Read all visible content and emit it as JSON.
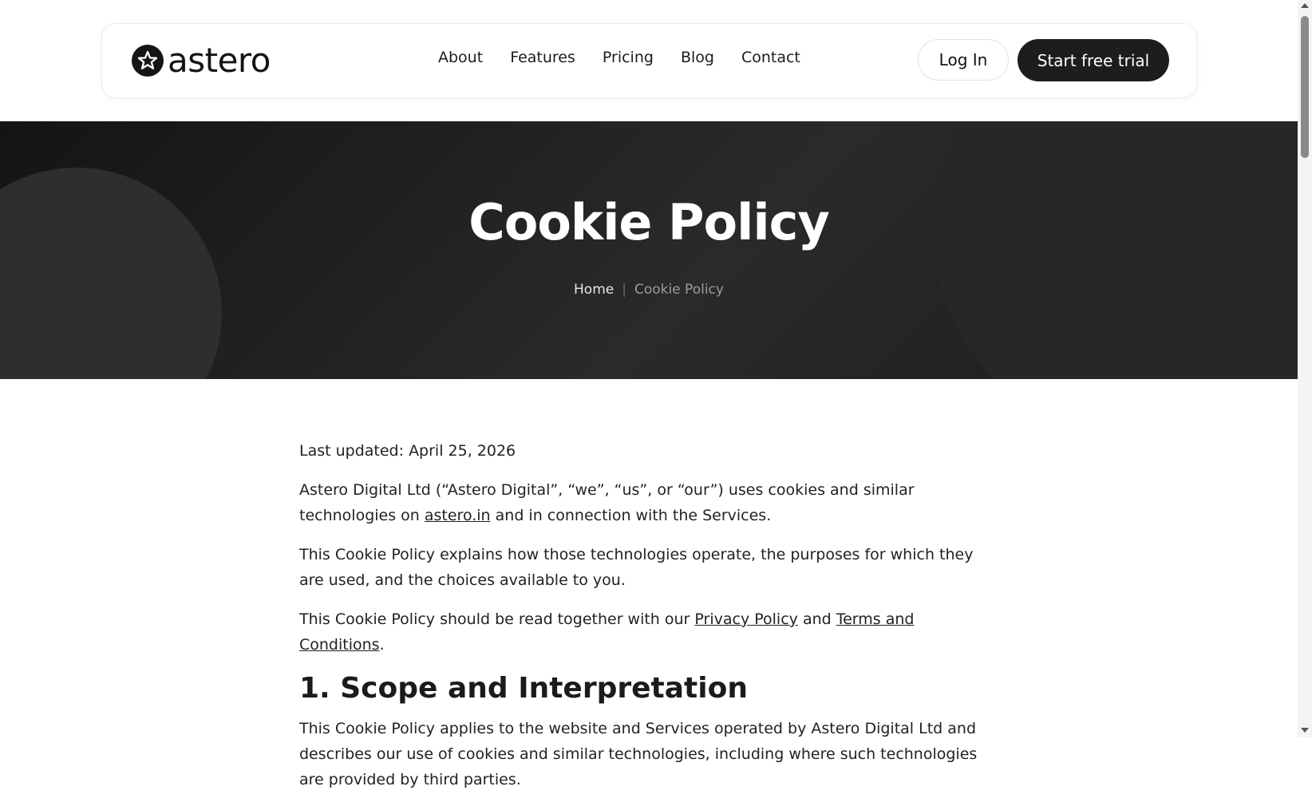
{
  "header": {
    "logo_text": "astero",
    "nav": [
      "About",
      "Features",
      "Pricing",
      "Blog",
      "Contact"
    ],
    "login_label": "Log In",
    "trial_label": "Start free trial"
  },
  "hero": {
    "title": "Cookie Policy",
    "breadcrumb_home": "Home",
    "breadcrumb_current": "Cookie Policy"
  },
  "content": {
    "last_updated": "Last updated: April 25, 2026",
    "p1_before": "Astero Digital Ltd (“Astero Digital”, “we”, “us”, or “our”) uses cookies and similar technologies on ",
    "p1_link": "astero.in",
    "p1_after": " and in connection with the Services.",
    "p2": "This Cookie Policy explains how those technologies operate, the purposes for which they are used, and the choices available to you.",
    "p3_before": "This Cookie Policy should be read together with our ",
    "p3_link1": "Privacy Policy",
    "p3_mid": " and ",
    "p3_link2": "Terms and Conditions",
    "p3_after": ".",
    "h1": "1. Scope and Interpretation",
    "p4": "This Cookie Policy applies to the website and Services operated by Astero Digital Ltd and describes our use of cookies and similar technologies, including where such technologies are provided by third parties."
  },
  "colors": {
    "primary_dark": "#1d1d1d",
    "hero_bg": "#1c1c1c",
    "text": "#222222"
  }
}
